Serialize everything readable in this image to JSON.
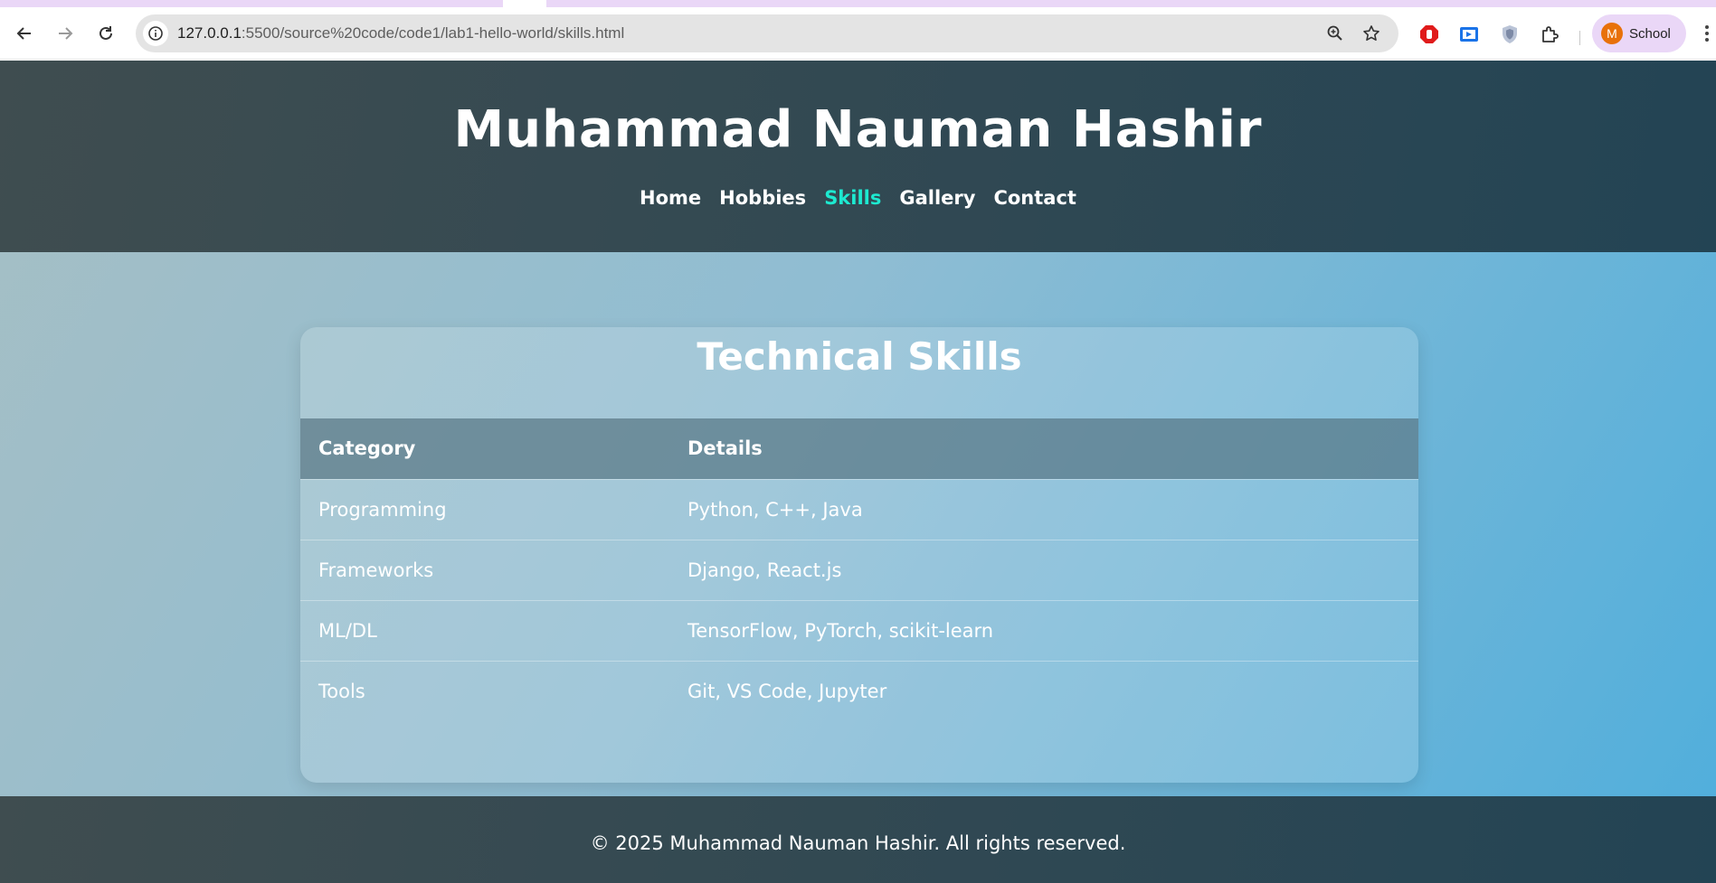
{
  "browser": {
    "url_host": "127.0.0.1",
    "url_rest": ":5500/source%20code/code1/lab1-hello-world/skills.html",
    "profile_initial": "M",
    "profile_name": "School",
    "icons": [
      "back-icon",
      "forward-icon",
      "reload-icon",
      "site-info-icon",
      "zoom-icon",
      "bookmark-star-icon",
      "adblock-extension-icon",
      "cast-extension-icon",
      "shield-extension-icon",
      "extensions-puzzle-icon",
      "menu-dots-icon"
    ]
  },
  "header": {
    "title": "Muhammad Nauman Hashir",
    "nav": [
      {
        "label": "Home"
      },
      {
        "label": "Hobbies"
      },
      {
        "label": "Skills"
      },
      {
        "label": "Gallery"
      },
      {
        "label": "Contact"
      }
    ],
    "active_nav": "Skills"
  },
  "skills": {
    "title": "Technical Skills",
    "columns": [
      "Category",
      "Details"
    ],
    "rows": [
      {
        "category": "Programming",
        "details": "Python, C++, Java"
      },
      {
        "category": "Frameworks",
        "details": "Django, React.js"
      },
      {
        "category": "ML/DL",
        "details": "TensorFlow, PyTorch, scikit-learn"
      },
      {
        "category": "Tools",
        "details": "Git, VS Code, Jupyter"
      }
    ]
  },
  "footer": {
    "text": "© 2025 Muhammad Nauman Hashir. All rights reserved."
  },
  "colors": {
    "accent_nav": "#1de9d0",
    "header_bg": "#2f4853",
    "profile_chip": "#ead7f7",
    "avatar": "#e8710a"
  }
}
